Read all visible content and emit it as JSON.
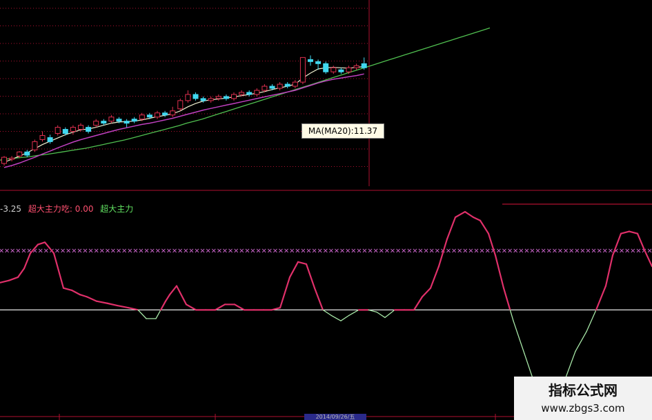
{
  "chart_data": [
    {
      "type": "candlestick",
      "ma_tooltip": "MA(MA20):11.37",
      "colors": {
        "up": "#e03050",
        "down": "#40d8f0",
        "ma_short": "#f0f0d0",
        "ma_mid": "#c040c0",
        "ma_long": "#50c050",
        "grid": "#b01030"
      },
      "candles": [
        {
          "o": 9.02,
          "c": 9.17,
          "h": 9.2,
          "l": 8.97
        },
        {
          "o": 9.12,
          "c": 9.15,
          "h": 9.2,
          "l": 9.07
        },
        {
          "o": 9.2,
          "c": 9.3,
          "h": 9.32,
          "l": 9.15
        },
        {
          "o": 9.3,
          "c": 9.22,
          "h": 9.35,
          "l": 9.17
        },
        {
          "o": 9.35,
          "c": 9.55,
          "h": 9.6,
          "l": 9.3
        },
        {
          "o": 9.6,
          "c": 9.7,
          "h": 9.8,
          "l": 9.55
        },
        {
          "o": 9.65,
          "c": 9.55,
          "h": 9.72,
          "l": 9.5
        },
        {
          "o": 9.75,
          "c": 9.9,
          "h": 9.95,
          "l": 9.7
        },
        {
          "o": 9.85,
          "c": 9.75,
          "h": 9.9,
          "l": 9.7
        },
        {
          "o": 9.8,
          "c": 9.9,
          "h": 9.95,
          "l": 9.72
        },
        {
          "o": 9.85,
          "c": 9.95,
          "h": 10.0,
          "l": 9.8
        },
        {
          "o": 9.9,
          "c": 9.8,
          "h": 9.95,
          "l": 9.75
        },
        {
          "o": 9.95,
          "c": 10.05,
          "h": 10.1,
          "l": 9.9
        },
        {
          "o": 10.05,
          "c": 10.0,
          "h": 10.1,
          "l": 9.95
        },
        {
          "o": 10.05,
          "c": 10.15,
          "h": 10.2,
          "l": 10.0
        },
        {
          "o": 10.1,
          "c": 10.05,
          "h": 10.15,
          "l": 10.0
        },
        {
          "o": 10.05,
          "c": 10.0,
          "h": 10.1,
          "l": 9.9
        },
        {
          "o": 10.1,
          "c": 10.05,
          "h": 10.15,
          "l": 10.0
        },
        {
          "o": 10.1,
          "c": 10.2,
          "h": 10.25,
          "l": 10.05
        },
        {
          "o": 10.2,
          "c": 10.15,
          "h": 10.25,
          "l": 10.1
        },
        {
          "o": 10.15,
          "c": 10.25,
          "h": 10.3,
          "l": 10.1
        },
        {
          "o": 10.25,
          "c": 10.2,
          "h": 10.3,
          "l": 10.15
        },
        {
          "o": 10.2,
          "c": 10.3,
          "h": 10.4,
          "l": 10.15
        },
        {
          "o": 10.35,
          "c": 10.55,
          "h": 10.6,
          "l": 10.3
        },
        {
          "o": 10.55,
          "c": 10.7,
          "h": 10.8,
          "l": 10.5
        },
        {
          "o": 10.7,
          "c": 10.6,
          "h": 10.75,
          "l": 10.55
        },
        {
          "o": 10.6,
          "c": 10.55,
          "h": 10.65,
          "l": 10.5
        },
        {
          "o": 10.55,
          "c": 10.6,
          "h": 10.65,
          "l": 10.5
        },
        {
          "o": 10.6,
          "c": 10.65,
          "h": 10.7,
          "l": 10.55
        },
        {
          "o": 10.65,
          "c": 10.6,
          "h": 10.7,
          "l": 10.55
        },
        {
          "o": 10.6,
          "c": 10.7,
          "h": 10.75,
          "l": 10.55
        },
        {
          "o": 10.7,
          "c": 10.75,
          "h": 10.8,
          "l": 10.65
        },
        {
          "o": 10.75,
          "c": 10.7,
          "h": 10.8,
          "l": 10.65
        },
        {
          "o": 10.7,
          "c": 10.8,
          "h": 10.85,
          "l": 10.65
        },
        {
          "o": 10.8,
          "c": 10.9,
          "h": 10.95,
          "l": 10.75
        },
        {
          "o": 10.9,
          "c": 10.85,
          "h": 10.95,
          "l": 10.8
        },
        {
          "o": 10.85,
          "c": 10.95,
          "h": 11.0,
          "l": 10.8
        },
        {
          "o": 10.95,
          "c": 10.9,
          "h": 11.0,
          "l": 10.85
        },
        {
          "o": 10.9,
          "c": 11.0,
          "h": 11.05,
          "l": 10.85
        },
        {
          "o": 11.0,
          "c": 11.6,
          "h": 11.6,
          "l": 10.95
        },
        {
          "o": 11.55,
          "c": 11.5,
          "h": 11.65,
          "l": 11.4
        },
        {
          "o": 11.5,
          "c": 11.45,
          "h": 11.55,
          "l": 11.3
        },
        {
          "o": 11.45,
          "c": 11.25,
          "h": 11.5,
          "l": 11.2
        },
        {
          "o": 11.25,
          "c": 11.35,
          "h": 11.4,
          "l": 11.2
        },
        {
          "o": 11.3,
          "c": 11.25,
          "h": 11.35,
          "l": 11.2
        },
        {
          "o": 11.25,
          "c": 11.35,
          "h": 11.4,
          "l": 11.2
        },
        {
          "o": 11.35,
          "c": 11.4,
          "h": 11.45,
          "l": 11.3
        },
        {
          "o": 11.45,
          "c": 11.35,
          "h": 11.6,
          "l": 11.3
        }
      ],
      "ma_short": [
        9.05,
        9.12,
        9.2,
        9.28,
        9.38,
        9.48,
        9.56,
        9.64,
        9.72,
        9.78,
        9.84,
        9.86,
        9.9,
        9.95,
        10.0,
        10.03,
        10.04,
        10.05,
        10.08,
        10.12,
        10.16,
        10.19,
        10.23,
        10.3,
        10.4,
        10.48,
        10.54,
        10.57,
        10.59,
        10.61,
        10.64,
        10.67,
        10.7,
        10.73,
        10.77,
        10.82,
        10.86,
        10.9,
        10.95,
        11.1,
        11.22,
        11.32,
        11.35,
        11.36,
        11.35,
        11.34,
        11.36,
        11.38
      ],
      "ma_mid": [
        8.92,
        8.97,
        9.03,
        9.1,
        9.17,
        9.25,
        9.32,
        9.4,
        9.47,
        9.54,
        9.6,
        9.65,
        9.7,
        9.75,
        9.8,
        9.85,
        9.89,
        9.93,
        9.97,
        10.0,
        10.04,
        10.08,
        10.12,
        10.17,
        10.22,
        10.27,
        10.32,
        10.36,
        10.4,
        10.44,
        10.48,
        10.52,
        10.56,
        10.6,
        10.64,
        10.68,
        10.72,
        10.76,
        10.8,
        10.86,
        10.92,
        10.98,
        11.03,
        11.07,
        11.1,
        11.13,
        11.16,
        11.2
      ],
      "ma_long": {
        "x0": 0,
        "x1": 63,
        "values": [
          9.1,
          9.13,
          9.15,
          9.17,
          9.19,
          9.22,
          9.24,
          9.27,
          9.3,
          9.33,
          9.36,
          9.39,
          9.43,
          9.47,
          9.51,
          9.55,
          9.59,
          9.64,
          9.69,
          9.74,
          9.79,
          9.84,
          9.89,
          9.94,
          10.0,
          10.05,
          10.1,
          10.16,
          10.22,
          10.28,
          10.34,
          10.4,
          10.46,
          10.52,
          10.58,
          10.64,
          10.7,
          10.76,
          10.82,
          10.88,
          10.94,
          11.0,
          11.06,
          11.12,
          11.18,
          11.24,
          11.3,
          11.36,
          11.42,
          11.48,
          11.54,
          11.6,
          11.66,
          11.72,
          11.78,
          11.84,
          11.9,
          11.96,
          12.02,
          12.08,
          12.14,
          12.2,
          12.26,
          12.32
        ]
      },
      "ylim": [
        8.6,
        13.0
      ]
    },
    {
      "type": "line",
      "legend": [
        {
          "text": "-3.25",
          "color": "#d0d0d0"
        },
        {
          "text": "超大主力吃: 0.00",
          "color": "#ff5070"
        },
        {
          "text": "超大主力",
          "color": "#60e060"
        }
      ],
      "series_color_above": "#e0306a",
      "series_color_below": "#a8e8a8",
      "zero_line": 0,
      "dashed_level": 55,
      "dashed_level_color": "#e070e0",
      "ylim": [
        -70,
        85
      ],
      "x": [
        0,
        13,
        26,
        35,
        44,
        55,
        65,
        78,
        92,
        104,
        116,
        126,
        140,
        156,
        170,
        186,
        200,
        212,
        226,
        240,
        246,
        256,
        270,
        284,
        298,
        312,
        326,
        340,
        354,
        368,
        382,
        394,
        406,
        420,
        432,
        444,
        456,
        468,
        480,
        494,
        506,
        520,
        534,
        546,
        558,
        572,
        586,
        600,
        612,
        624,
        636,
        648,
        660,
        674,
        686,
        696,
        708,
        718,
        730,
        744,
        760,
        776,
        790,
        806,
        820,
        834,
        850,
        864,
        878,
        888,
        900,
        912,
        924,
        934,
        945
      ],
      "values": [
        25,
        27,
        30,
        38,
        52,
        60,
        62,
        52,
        20,
        18,
        14,
        12,
        8,
        6,
        4,
        2,
        0,
        -8,
        -8,
        8,
        14,
        22,
        5,
        0,
        0,
        0,
        5,
        5,
        0,
        0,
        0,
        0,
        2,
        30,
        44,
        42,
        20,
        0,
        -5,
        -10,
        -5,
        0,
        0,
        -2,
        -7,
        0,
        0,
        0,
        12,
        20,
        40,
        65,
        85,
        90,
        85,
        82,
        70,
        50,
        20,
        -10,
        -40,
        -70,
        -70,
        -70,
        -62,
        -38,
        -20,
        0,
        22,
        50,
        70,
        72,
        70,
        55,
        40
      ]
    }
  ],
  "watermark": {
    "title": "指标公式网",
    "url": "www.zbgs3.com"
  },
  "date_label": "2014/09/26/五"
}
